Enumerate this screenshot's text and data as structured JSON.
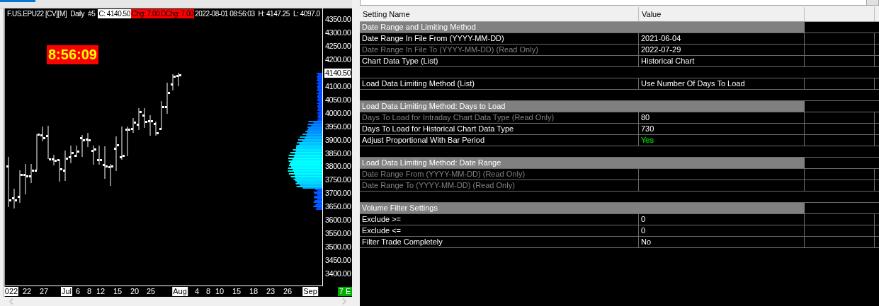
{
  "chart": {
    "quote_bar": [
      {
        "text": "F.US.EPU22 [CV][M]",
        "kind": "plain"
      },
      {
        "text": "Daily",
        "kind": "plain"
      },
      {
        "text": "#5",
        "kind": "plain"
      },
      {
        "text": "C: 4140.50",
        "kind": "white"
      },
      {
        "text": "Chg: 7.00",
        "kind": "red"
      },
      {
        "text": "DChg: 7.00",
        "kind": "red"
      },
      {
        "text": "2022-08-01 08:56:03",
        "kind": "plain"
      },
      {
        "text": "H: 4147.25",
        "kind": "plain"
      },
      {
        "text": "L: 4097.0",
        "kind": "plain"
      }
    ],
    "clock": "8:56:09",
    "price_axis": [
      {
        "label": "4350.00",
        "highlighted": false
      },
      {
        "label": "4300.00",
        "highlighted": false
      },
      {
        "label": "4250.00",
        "highlighted": false
      },
      {
        "label": "4200.00",
        "highlighted": false
      },
      {
        "label": "4140.50",
        "highlighted": true
      },
      {
        "label": "4100.00",
        "highlighted": false
      },
      {
        "label": "4050.00",
        "highlighted": false
      },
      {
        "label": "4000.00",
        "highlighted": false
      },
      {
        "label": "3950.00",
        "highlighted": false
      },
      {
        "label": "3900.00",
        "highlighted": false
      },
      {
        "label": "3850.00",
        "highlighted": false
      },
      {
        "label": "3800.00",
        "highlighted": false
      },
      {
        "label": "3750.00",
        "highlighted": false
      },
      {
        "label": "3700.00",
        "highlighted": false
      },
      {
        "label": "3650.00",
        "highlighted": false
      },
      {
        "label": "3600.00",
        "highlighted": false
      },
      {
        "label": "3550.00",
        "highlighted": false
      },
      {
        "label": "3500.00",
        "highlighted": false
      },
      {
        "label": "3450.00",
        "highlighted": false
      },
      {
        "label": "3400.00",
        "highlighted": false
      }
    ],
    "date_axis": [
      {
        "label": "022",
        "highlighted": true
      },
      {
        "label": "22",
        "highlighted": false
      },
      {
        "label": "27",
        "highlighted": false
      },
      {
        "label": "Jul",
        "highlighted": true
      },
      {
        "label": "6",
        "highlighted": false
      },
      {
        "label": "8",
        "highlighted": false
      },
      {
        "label": "12",
        "highlighted": false
      },
      {
        "label": "15",
        "highlighted": false
      },
      {
        "label": "20",
        "highlighted": false
      },
      {
        "label": "25",
        "highlighted": false
      },
      {
        "label": "Aug",
        "highlighted": true
      },
      {
        "label": "4",
        "highlighted": false
      },
      {
        "label": "8",
        "highlighted": false
      },
      {
        "label": "10",
        "highlighted": false
      },
      {
        "label": "15",
        "highlighted": false
      },
      {
        "label": "18",
        "highlighted": false
      },
      {
        "label": "23",
        "highlighted": false
      },
      {
        "label": "26",
        "highlighted": false
      },
      {
        "label": "Sep",
        "highlighted": true
      }
    ],
    "status_badge": "7 E"
  },
  "settings": {
    "columns": [
      "Setting Name",
      "Value"
    ],
    "rows": [
      {
        "kind": "section",
        "name": "Date Range and Limiting Method"
      },
      {
        "kind": "setting",
        "name": "Date Range In File From (YYYY-MM-DD)",
        "value": "2021-06-04",
        "read_only": false
      },
      {
        "kind": "setting",
        "name": "Date Range In File To (YYYY-MM-DD) (Read Only)",
        "value": "2022-07-29",
        "read_only": true
      },
      {
        "kind": "setting",
        "name": "Chart Data Type (List)",
        "value": "Historical Chart",
        "read_only": false
      },
      {
        "kind": "blank"
      },
      {
        "kind": "setting",
        "name": "Load Data Limiting Method (List)",
        "value": "Use Number Of Days To Load",
        "read_only": false
      },
      {
        "kind": "blank"
      },
      {
        "kind": "section",
        "name": "Load Data Limiting Method: Days to Load"
      },
      {
        "kind": "setting",
        "name": "Days To Load for Intraday Chart Data Type (Read Only)",
        "value": "80",
        "read_only": true
      },
      {
        "kind": "setting",
        "name": "Days To Load for Historical Chart Data Type",
        "value": "730",
        "read_only": false
      },
      {
        "kind": "setting",
        "name": "Adjust Proportional With Bar Period",
        "value": "Yes",
        "read_only": false,
        "color": "#00c000"
      },
      {
        "kind": "blank"
      },
      {
        "kind": "section",
        "name": "Load Data Limiting Method: Date Range"
      },
      {
        "kind": "setting",
        "name": "Date Range From (YYYY-MM-DD) (Read Only)",
        "read_only": true
      },
      {
        "kind": "setting",
        "name": "Date Range To (YYYY-MM-DD) (Read Only)",
        "read_only": true
      },
      {
        "kind": "blank"
      },
      {
        "kind": "section",
        "name": "Volume Filter Settings"
      },
      {
        "kind": "setting",
        "name": "Exclude >=",
        "value": "0",
        "read_only": false
      },
      {
        "kind": "setting",
        "name": "Exclude <=",
        "value": "0",
        "read_only": false
      },
      {
        "kind": "setting",
        "name": "Filter Trade Completely",
        "value": "No",
        "read_only": false
      }
    ]
  }
}
